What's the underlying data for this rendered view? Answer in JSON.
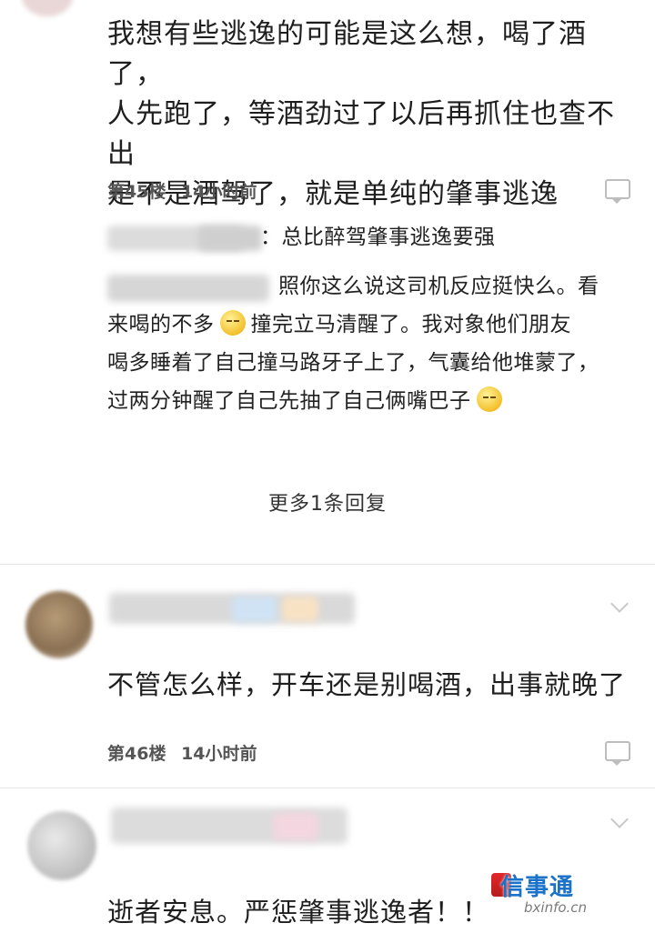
{
  "comments": [
    {
      "body_lines": [
        "我想有些逃逸的可能是这么想，喝了酒了，",
        "人先跑了，等酒劲过了以后再抓住也查不出",
        "是不是酒驾了，就是单纯的肇事逃逸"
      ],
      "floor": "第45楼",
      "time": "14小时前",
      "replies": [
        {
          "text": "：总比醉驾肇事逃逸要强"
        },
        {
          "line1": "照你这么说这司机反应挺快么。看",
          "line2_a": "来喝的不多",
          "line2_b": "撞完立马清醒了。我对象他们朋友",
          "line3": "喝多睡着了自己撞马路牙子上了，气囊给他堆蒙了，",
          "line4": "过两分钟醒了自己先抽了自己俩嘴巴子"
        }
      ],
      "more_replies_label": "更多1条回复"
    },
    {
      "body": "不管怎么样，开车还是别喝酒，出事就晚了",
      "floor": "第46楼",
      "time": "14小时前"
    },
    {
      "body": "逝者安息。严惩肇事逃逸者！！"
    }
  ],
  "watermark": {
    "title": "信事通",
    "site": "bxinfo.cn"
  },
  "icons": {
    "reply": "reply-bubble-icon",
    "expand": "chevron-down-icon",
    "emoji": "smirk-emoji-icon"
  },
  "colors": {
    "text": "#1e1e1e",
    "meta": "#555555",
    "divider": "#e6e6e6",
    "watermark": "#1a73c9"
  }
}
